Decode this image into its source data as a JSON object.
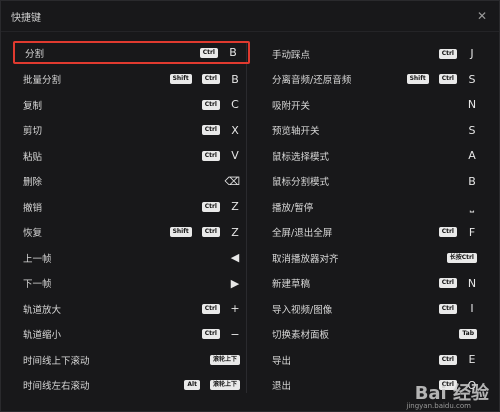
{
  "window": {
    "title": "快捷键"
  },
  "left": [
    {
      "label": "分割",
      "badges": [
        "Ctrl"
      ],
      "key": "B",
      "highlight": true
    },
    {
      "label": "批量分割",
      "badges": [
        "Shift",
        "Ctrl"
      ],
      "key": "B"
    },
    {
      "label": "复制",
      "badges": [
        "Ctrl"
      ],
      "key": "C"
    },
    {
      "label": "剪切",
      "badges": [
        "Ctrl"
      ],
      "key": "X"
    },
    {
      "label": "粘贴",
      "badges": [
        "Ctrl"
      ],
      "key": "V"
    },
    {
      "label": "删除",
      "badges": [],
      "key": "⌫"
    },
    {
      "label": "撤销",
      "badges": [
        "Ctrl"
      ],
      "key": "Z"
    },
    {
      "label": "恢复",
      "badges": [
        "Shift",
        "Ctrl"
      ],
      "key": "Z"
    },
    {
      "label": "上一帧",
      "badges": [],
      "key": "◀"
    },
    {
      "label": "下一帧",
      "badges": [],
      "key": "▶"
    },
    {
      "label": "轨道放大",
      "badges": [
        "Ctrl"
      ],
      "key": "+"
    },
    {
      "label": "轨道缩小",
      "badges": [
        "Ctrl"
      ],
      "key": "−"
    },
    {
      "label": "时间线上下滚动",
      "badges": [
        "滚轮上下"
      ],
      "key": ""
    },
    {
      "label": "时间线左右滚动",
      "badges": [
        "Alt",
        "滚轮上下"
      ],
      "key": ""
    }
  ],
  "right": [
    {
      "label": "手动踩点",
      "badges": [
        "Ctrl"
      ],
      "key": "J"
    },
    {
      "label": "分离音频/还原音频",
      "badges": [
        "Shift",
        "Ctrl"
      ],
      "key": "S"
    },
    {
      "label": "吸附开关",
      "badges": [],
      "key": "N"
    },
    {
      "label": "预览轴开关",
      "badges": [],
      "key": "S"
    },
    {
      "label": "鼠标选择模式",
      "badges": [],
      "key": "A"
    },
    {
      "label": "鼠标分割模式",
      "badges": [],
      "key": "B"
    },
    {
      "label": "播放/暂停",
      "badges": [],
      "key": "⎵"
    },
    {
      "label": "全屏/退出全屏",
      "badges": [
        "Ctrl"
      ],
      "key": "F"
    },
    {
      "label": "取消播放器对齐",
      "badges": [
        "长按Ctrl"
      ],
      "key": ""
    },
    {
      "label": "新建草稿",
      "badges": [
        "Ctrl"
      ],
      "key": "N"
    },
    {
      "label": "导入视频/图像",
      "badges": [
        "Ctrl"
      ],
      "key": "I"
    },
    {
      "label": "切换素材面板",
      "badges": [
        "Tab"
      ],
      "key": ""
    },
    {
      "label": "导出",
      "badges": [
        "Ctrl"
      ],
      "key": "E"
    },
    {
      "label": "退出",
      "badges": [
        "Ctrl"
      ],
      "key": "Q"
    }
  ],
  "watermark": {
    "text": "Bai 经验",
    "sub": "jingyan.baidu.com"
  }
}
